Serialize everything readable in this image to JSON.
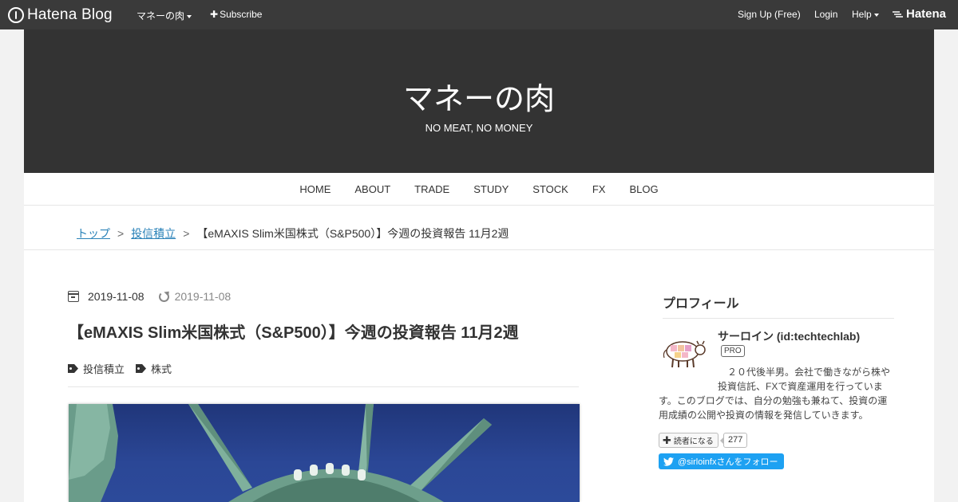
{
  "topbar": {
    "logo": "Hatena Blog",
    "blog_menu": "マネーの肉",
    "subscribe": "Subscribe",
    "signup": "Sign Up (Free)",
    "login": "Login",
    "help": "Help",
    "hatena": "Hatena"
  },
  "hero": {
    "title": "マネーの肉",
    "description": "NO MEAT, NO MONEY"
  },
  "nav": {
    "items": [
      "HOME",
      "ABOUT",
      "TRADE",
      "STUDY",
      "STOCK",
      "FX",
      "BLOG"
    ]
  },
  "breadcrumb": {
    "top": "トップ",
    "sep": ">",
    "category": "投信積立",
    "current": "【eMAXIS Slim米国株式（S&P500）】今週の投資報告 11月2週"
  },
  "article": {
    "date": "2019-11-08",
    "updated": "2019-11-08",
    "title": "【eMAXIS Slim米国株式（S&P500）】今週の投資報告 11月2週",
    "categories": [
      "投信積立",
      "株式"
    ]
  },
  "sidebar": {
    "heading": "プロフィール",
    "name": "サーロイン (id:techtechlab)",
    "badge": "PRO",
    "description_1": "２０代後半男。会社で働きながら株や投資信託、FXで資産運用を行っていま",
    "description_2": "す。このブログでは、自分の勉強も兼ねて、投資の運用成績の公開や投資の情報を発信していきます。",
    "reader_button": "読者になる",
    "reader_count": "277",
    "twitter_button": "@sirloinfxさんをフォロー"
  },
  "colors": {
    "topbar_bg": "#3a3a3a",
    "hero_bg": "#333333",
    "link": "#2a82b8",
    "twitter": "#1da1f2"
  }
}
